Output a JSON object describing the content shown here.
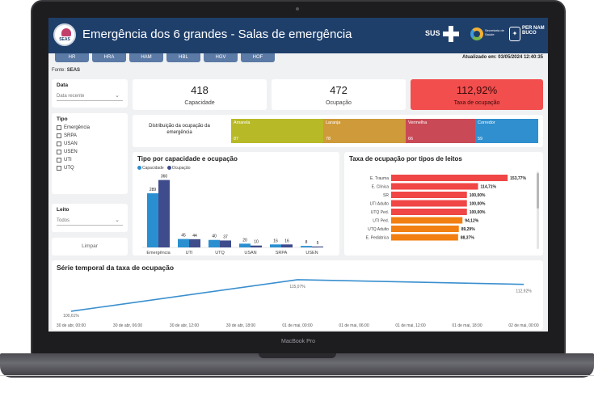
{
  "device": {
    "brand": "MacBook Pro"
  },
  "header": {
    "logo_text": "SEAS",
    "title": "Emergência dos 6 grandes - Salas de emergência",
    "sus": "SUS",
    "secretaria": "Secretaria de Saúde",
    "pe_logo": "PER NAM BUCO"
  },
  "tabs": [
    "HR",
    "HRA",
    "HAM",
    "HBL",
    "HGV",
    "HOF"
  ],
  "updated": "Atualizado em: 03/05/2024 12:40:35",
  "fonte": {
    "label": "Fonte:",
    "value": "SEAS"
  },
  "filters": {
    "data_label": "Data",
    "data_value": "Data recente",
    "tipo_label": "Tipo",
    "tipo_options": [
      "Emergência",
      "SRPA",
      "USAN",
      "USEN",
      "UTI",
      "UTQ"
    ],
    "leito_label": "Leito",
    "leito_value": "Todos",
    "clear_button": "Limpar"
  },
  "kpis": [
    {
      "value": "418",
      "label": "Capacidade"
    },
    {
      "value": "472",
      "label": "Ocupação"
    },
    {
      "value": "112,92%",
      "label": "Taxa de ocupação"
    }
  ],
  "distribution": {
    "label": "Distribuição da ocupação da emergência",
    "segments": [
      {
        "name": "Amarela",
        "value": "87",
        "color": "#b8b927"
      },
      {
        "name": "Laranja",
        "value": "78",
        "color": "#cf9a3a"
      },
      {
        "name": "Vermelha",
        "value": "66",
        "color": "#c94956"
      },
      {
        "name": "Corredor",
        "value": "59",
        "color": "#2f8fcf"
      }
    ]
  },
  "chart_bar_title": "Tipo por capacidade e ocupação",
  "chart_hbar_title": "Taxa de ocupação por tipos de leitos",
  "chart_line_title": "Série temporal da taxa de ocupação",
  "colors": {
    "capacidade": "#2a8fd0",
    "ocupacao": "#3f4c8c",
    "red": "#f04646",
    "orange": "#f27f12",
    "line": "#3a8fcf"
  },
  "chart_data": [
    {
      "type": "bar",
      "title": "Tipo por capacidade e ocupação",
      "categories": [
        "Emergência",
        "UTI",
        "UTQ",
        "USAN",
        "SRPA",
        "USEN"
      ],
      "series": [
        {
          "name": "Capacidade",
          "values": [
            289,
            45,
            40,
            20,
            16,
            8
          ]
        },
        {
          "name": "Ocupação",
          "values": [
            360,
            44,
            37,
            10,
            16,
            5
          ]
        }
      ],
      "ylim": [
        0,
        380
      ]
    },
    {
      "type": "bar",
      "orientation": "horizontal",
      "title": "Taxa de ocupação por tipos de leitos",
      "categories": [
        "E. Trauma",
        "E. Clínica",
        "SR",
        "UTI Adulto",
        "UTQ Ped.",
        "UTI Ped.",
        "UTQ Adulto",
        "E. Pediátrica"
      ],
      "values": [
        153.77,
        114.71,
        100.0,
        100.0,
        100.0,
        94.12,
        89.29,
        88.37
      ],
      "labels": [
        "153,77%",
        "114,71%",
        "100,00%",
        "100,00%",
        "100,00%",
        "94,12%",
        "89,29%",
        "88,37%"
      ],
      "xlim": [
        0,
        160
      ]
    },
    {
      "type": "line",
      "title": "Série temporal da taxa de ocupação",
      "x": [
        "30 de abr, 00:00",
        "01 de mai, 00:00",
        "02 de mai, 00:00"
      ],
      "y": [
        100.61,
        115.07,
        112.92
      ],
      "point_labels": [
        "100,61%",
        "115,07%",
        "112,92%"
      ],
      "x_ticks": [
        "30 de abr, 00:00",
        "30 de abr, 06:00",
        "30 de abr, 12:00",
        "30 de abr, 18:00",
        "01 de mai, 00:00",
        "01 de mai, 06:00",
        "01 de mai, 12:00",
        "01 de mai, 18:00",
        "02 de mai, 00:00"
      ],
      "ylim": [
        98,
        118
      ]
    }
  ]
}
